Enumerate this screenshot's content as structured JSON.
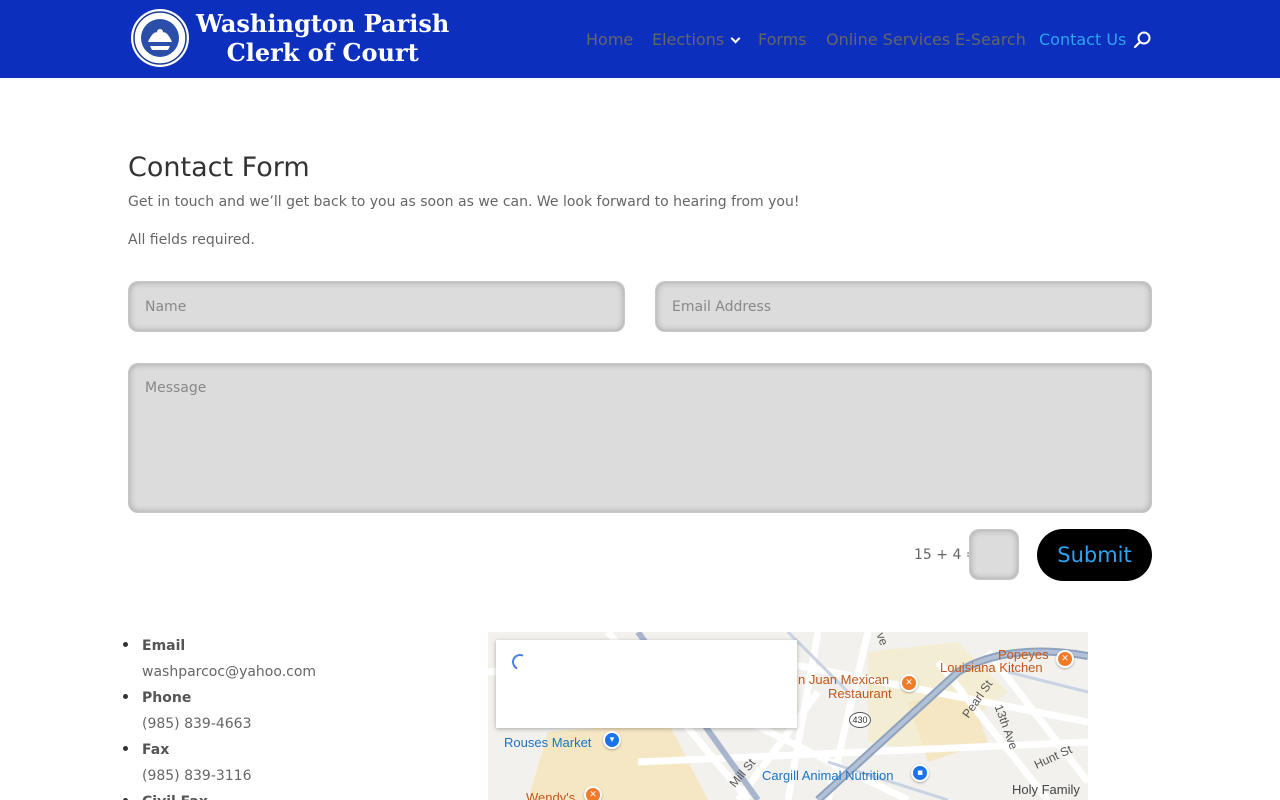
{
  "header": {
    "logo_line1": "Washington Parish",
    "logo_line2": "Clerk of Court",
    "nav": [
      {
        "label": "Home",
        "active": false
      },
      {
        "label": "Elections",
        "active": false,
        "has_dropdown": true
      },
      {
        "label": "Forms",
        "active": false
      },
      {
        "label": "Online Services",
        "active": false
      },
      {
        "label": "E-Search",
        "active": false
      },
      {
        "label": "Contact Us",
        "active": true
      }
    ],
    "search_icon": "search-icon"
  },
  "form": {
    "title": "Contact Form",
    "lead": "Get in touch and we’ll get back to you as soon as we can. We look forward to hearing from you!",
    "required_note": "All fields required.",
    "name_placeholder": "Name",
    "email_placeholder": "Email Address",
    "message_placeholder": "Message",
    "captcha_question": "15 + 4 =",
    "submit_label": "Submit"
  },
  "contact": [
    {
      "label": "Email",
      "value": "washparcoc@yahoo.com"
    },
    {
      "label": "Phone",
      "value": "(985) 839-4663"
    },
    {
      "label": "Fax",
      "value": "(985) 839-3116"
    },
    {
      "label": "Civil Fax",
      "value": ""
    }
  ],
  "map": {
    "pois": [
      {
        "name": "Popeyes",
        "color": "orange"
      },
      {
        "name": "Louisiana Kitchen",
        "color": "orange"
      },
      {
        "name": "n Juan Mexican",
        "color": "orange"
      },
      {
        "name": "Restaurant",
        "color": "orange"
      },
      {
        "name": "Rouses Market",
        "color": "blue"
      },
      {
        "name": "Cargill Animal Nutrition",
        "color": "blue"
      },
      {
        "name": "Wendy's",
        "color": "orange"
      },
      {
        "name": "Holy Family",
        "color": "dark"
      }
    ],
    "streets": [
      "Pearl St",
      "13th Ave",
      "Hunt St",
      "Mill St",
      "ve"
    ],
    "route_shield": "430"
  },
  "colors": {
    "header_bg": "#0c2fbd",
    "accent": "#2ea3f2",
    "submit_bg": "#000000",
    "field_bg": "#dcdcdc"
  }
}
